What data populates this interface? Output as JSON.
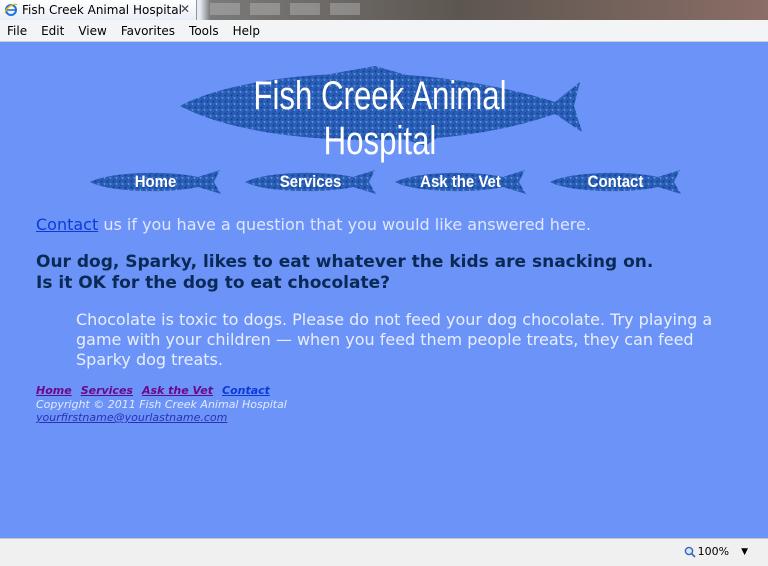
{
  "browser": {
    "tab_title": "Fish Creek Animal Hospital",
    "close_glyph": "✕",
    "menu": [
      "File",
      "Edit",
      "View",
      "Favorites",
      "Tools",
      "Help"
    ],
    "zoom": "100%"
  },
  "site": {
    "banner_title": "Fish Creek Animal Hospital",
    "nav": [
      "Home",
      "Services",
      "Ask the Vet",
      "Contact"
    ],
    "intro_link": "Contact",
    "intro_rest": " us if you have a question that you would like answered here.",
    "question_line1": "Our dog, Sparky, likes to eat whatever the kids are snacking on.",
    "question_line2": "Is it OK for the dog to eat chocolate?",
    "answer": "Chocolate is toxic to dogs. Please do not feed your dog chocolate. Try playing a game with your children — when you feed them people treats, they can feed Sparky dog treats.",
    "footer_nav": [
      "Home",
      "Services",
      "Ask the Vet",
      "Contact"
    ],
    "copyright": "Copyright © 2011 Fish Creek Animal Hospital",
    "email": "yourfirstname@yourlastname.com"
  },
  "colors": {
    "page_background": "#6c94f8",
    "fish_blue": "#1f4fa8",
    "link_blue": "#0b3bd6",
    "visited_purple": "#6a0a8a",
    "question_text": "#0a2a55"
  }
}
